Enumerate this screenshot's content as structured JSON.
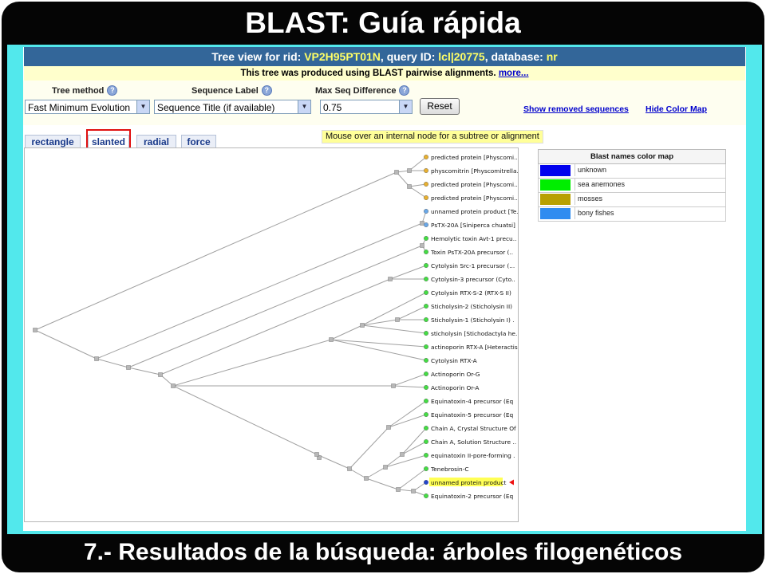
{
  "slide": {
    "title": "BLAST: Guía rápida",
    "footer": "7.- Resultados de la búsqueda: árboles filogenéticos"
  },
  "header": {
    "prefix_rid": "Tree view for rid: ",
    "rid": "VP2H95PT01N",
    "query_label": ", query ID: ",
    "query_id": "lcl|20775",
    "database_label": ", database: ",
    "database": "nr",
    "subtitle": "This tree was produced using BLAST pairwise alignments.",
    "more_link": "more..."
  },
  "controls": {
    "tree_method_label": "Tree method",
    "tree_method_value": "Fast Minimum Evolution",
    "sequence_label_label": "Sequence Label",
    "sequence_label_value": "Sequence Title (if available)",
    "max_seq_diff_label": "Max Seq Difference",
    "max_seq_diff_value": "0.75",
    "reset_label": "Reset",
    "show_removed_link": "Show removed sequences",
    "hide_color_map_link": "Hide Color Map",
    "help_glyph": "?"
  },
  "tabs": [
    {
      "label": "rectangle",
      "active": false
    },
    {
      "label": "slanted",
      "active": true
    },
    {
      "label": "radial",
      "active": false
    },
    {
      "label": "force",
      "active": false
    }
  ],
  "mouse_hint": "Mouse over an internal node for a subtree or alignment",
  "color_map": {
    "title": "Blast names color map",
    "entries": [
      {
        "label": "unknown",
        "color": "#0000ee"
      },
      {
        "label": "sea anemones",
        "color": "#00ee00"
      },
      {
        "label": "mosses",
        "color": "#b8a000"
      },
      {
        "label": "bony fishes",
        "color": "#2f8cf0"
      }
    ]
  },
  "tree": {
    "leaves": [
      {
        "label": "predicted protein [Physcomi..",
        "color": "#e8b030"
      },
      {
        "label": "physcomitrin [Physcomitrella..",
        "color": "#e8b030"
      },
      {
        "label": "predicted protein [Physcomi..",
        "color": "#e8b030"
      },
      {
        "label": "predicted protein [Physcomi..",
        "color": "#e8b030"
      },
      {
        "label": "unnamed protein product [Te..",
        "color": "#6aa8e8"
      },
      {
        "label": "PsTX-20A [Siniperca chuatsi]",
        "color": "#6aa8e8"
      },
      {
        "label": "Hemolytic toxin Avt-1 precu..",
        "color": "#44dd44"
      },
      {
        "label": "Toxin PsTX-20A precursor (..",
        "color": "#44dd44"
      },
      {
        "label": "Cytolysin Src-1 precursor (...",
        "color": "#44dd44"
      },
      {
        "label": "Cytolysin-3 precursor (Cyto..",
        "color": "#44dd44"
      },
      {
        "label": "Cytolysin RTX-S-2 (RTX-S II)",
        "color": "#44dd44"
      },
      {
        "label": "Sticholysin-2 (Sticholysin II)",
        "color": "#44dd44"
      },
      {
        "label": "Sticholysin-1 (Sticholysin I) .",
        "color": "#44dd44"
      },
      {
        "label": "sticholysin [Stichodactyla he..",
        "color": "#44dd44"
      },
      {
        "label": "actinoporin RTX-A [Heteractis",
        "color": "#44dd44"
      },
      {
        "label": "Cytolysin RTX-A",
        "color": "#44dd44"
      },
      {
        "label": "Actinoporin Or-G",
        "color": "#44dd44"
      },
      {
        "label": "Actinoporin Or-A",
        "color": "#44dd44"
      },
      {
        "label": "Equinatoxin-4 precursor (Eq",
        "color": "#44dd44"
      },
      {
        "label": "Equinatoxin-5 precursor (Eq",
        "color": "#44dd44"
      },
      {
        "label": "Chain A, Crystal Structure Of",
        "color": "#44dd44"
      },
      {
        "label": "Chain A, Solution Structure ..",
        "color": "#44dd44"
      },
      {
        "label": "equinatoxin II-pore-forming .",
        "color": "#44dd44"
      },
      {
        "label": "Tenebrosin-C",
        "color": "#44dd44"
      },
      {
        "label": "unnamed protein product",
        "color": "#2244cc",
        "highlight": true
      },
      {
        "label": "Equinatoxin-2 precursor (Eq",
        "color": "#44dd44"
      }
    ]
  }
}
